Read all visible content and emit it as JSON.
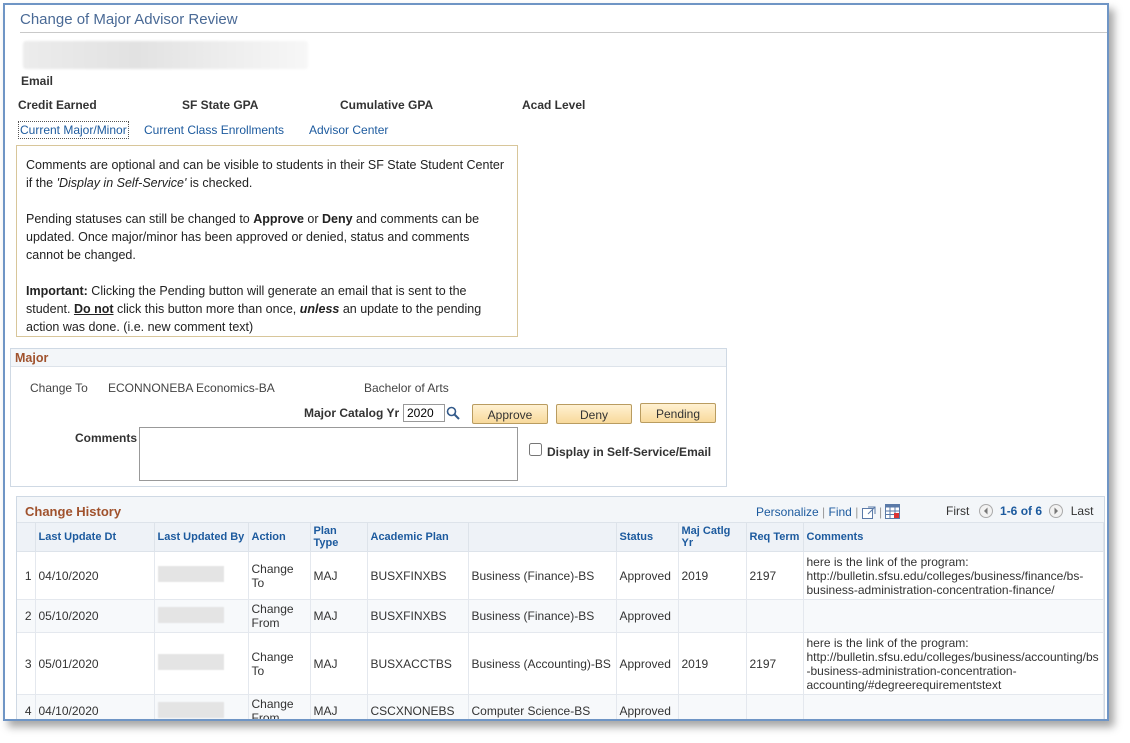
{
  "page": {
    "title": "Change of Major Advisor Review"
  },
  "student": {
    "email_label": "Email",
    "credit_label": "Credit Earned",
    "sfstate_gpa_label": "SF State GPA",
    "cum_gpa_label": "Cumulative GPA",
    "acad_level_label": "Acad Level"
  },
  "tabs": [
    {
      "label": "Current Major/Minor"
    },
    {
      "label": "Current Class Enrollments"
    },
    {
      "label": "Advisor Center"
    }
  ],
  "info": {
    "p1_a": "Comments are optional and can be visible to students in their SF State Student Center if the ",
    "p1_em": "'Display in Self-Service'",
    "p1_b": " is checked.",
    "p2_a": "Pending statuses can still be changed to ",
    "p2_approve": "Approve",
    "p2_or": " or ",
    "p2_deny": "Deny",
    "p2_b": " and comments can be updated. Once major/minor has been approved or denied, status and comments cannot be changed.",
    "p3_important": "Important:",
    "p3_a": " Clicking the Pending button will generate an email that is sent to the student. ",
    "p3_donot": "Do not",
    "p3_b": " click this button more than once, ",
    "p3_unless": "unless",
    "p3_c": " an update to the pending action was done. (i.e. new comment text)"
  },
  "major": {
    "header": "Major",
    "change_to_label": "Change To",
    "plan": "ECONNONEBA Economics-BA",
    "degree": "Bachelor of Arts",
    "catalog_label": "Major Catalog Yr",
    "catalog_value": "2020",
    "approve_label": "Approve",
    "deny_label": "Deny",
    "pending_label": "Pending",
    "comments_label": "Comments",
    "display_label": "Display in Self-Service/Email"
  },
  "history": {
    "title": "Change History",
    "personalize": "Personalize",
    "find": "Find",
    "first": "First",
    "range": "1-6 of 6",
    "last": "Last",
    "columns": [
      "Last Update Dt",
      "Last Updated By",
      "Action",
      "Plan Type",
      "Academic Plan",
      "",
      "Status",
      "Maj Catlg Yr",
      "Req Term",
      "Comments"
    ],
    "rows": [
      {
        "num": "1",
        "date": "04/10/2020",
        "action": "Change To",
        "plan_type": "MAJ",
        "plan": "BUSXFINXBS",
        "descr": "Business (Finance)-BS",
        "status": "Approved",
        "catlg": "2019",
        "term": "2197",
        "comments": "here is the link of the program: http://bulletin.sfsu.edu/colleges/business/finance/bs-business-administration-concentration-finance/"
      },
      {
        "num": "2",
        "date": "05/10/2020",
        "action": "Change From",
        "plan_type": "MAJ",
        "plan": "BUSXFINXBS",
        "descr": "Business (Finance)-BS",
        "status": "Approved",
        "catlg": "",
        "term": "",
        "comments": ""
      },
      {
        "num": "3",
        "date": "05/01/2020",
        "action": "Change To",
        "plan_type": "MAJ",
        "plan": "BUSXACCTBS",
        "descr": "Business (Accounting)-BS",
        "status": "Approved",
        "catlg": "2019",
        "term": "2197",
        "comments": "here is the link of the program: http://bulletin.sfsu.edu/colleges/business/accounting/bs-business-administration-concentration-accounting/#degreerequirementstext"
      },
      {
        "num": "4",
        "date": "04/10/2020",
        "action": "Change From",
        "plan_type": "MAJ",
        "plan": "CSCXNONEBS",
        "descr": "Computer Science-BS",
        "status": "Approved",
        "catlg": "",
        "term": "",
        "comments": ""
      }
    ]
  },
  "icons": {
    "search": "magnifier-icon",
    "zoom": "new-window-icon",
    "download": "spreadsheet-icon",
    "prev": "arrow-left-icon",
    "next": "arrow-right-icon"
  }
}
